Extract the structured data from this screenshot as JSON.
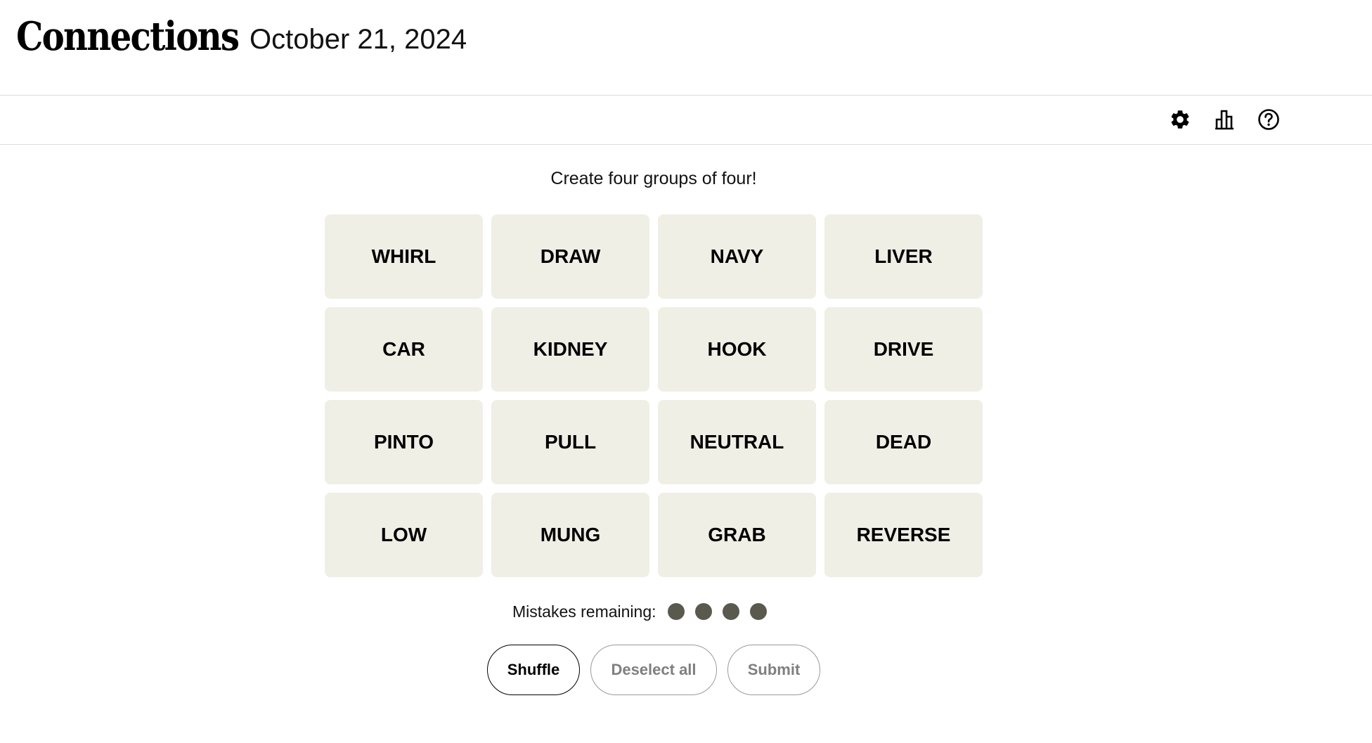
{
  "header": {
    "title": "Connections",
    "date": "October 21, 2024"
  },
  "toolbar": {
    "icons": [
      "gear-icon",
      "stats-icon",
      "help-icon"
    ]
  },
  "instructions": "Create four groups of four!",
  "tiles": [
    "WHIRL",
    "DRAW",
    "NAVY",
    "LIVER",
    "CAR",
    "KIDNEY",
    "HOOK",
    "DRIVE",
    "PINTO",
    "PULL",
    "NEUTRAL",
    "DEAD",
    "LOW",
    "MUNG",
    "GRAB",
    "REVERSE"
  ],
  "mistakes": {
    "label": "Mistakes remaining:",
    "remaining": 4
  },
  "buttons": {
    "shuffle": "Shuffle",
    "deselect_all": "Deselect all",
    "submit": "Submit"
  },
  "colors": {
    "tile_background": "#efefe6",
    "mistake_dot": "#5a594e",
    "disabled_text": "#7f7f7f"
  }
}
